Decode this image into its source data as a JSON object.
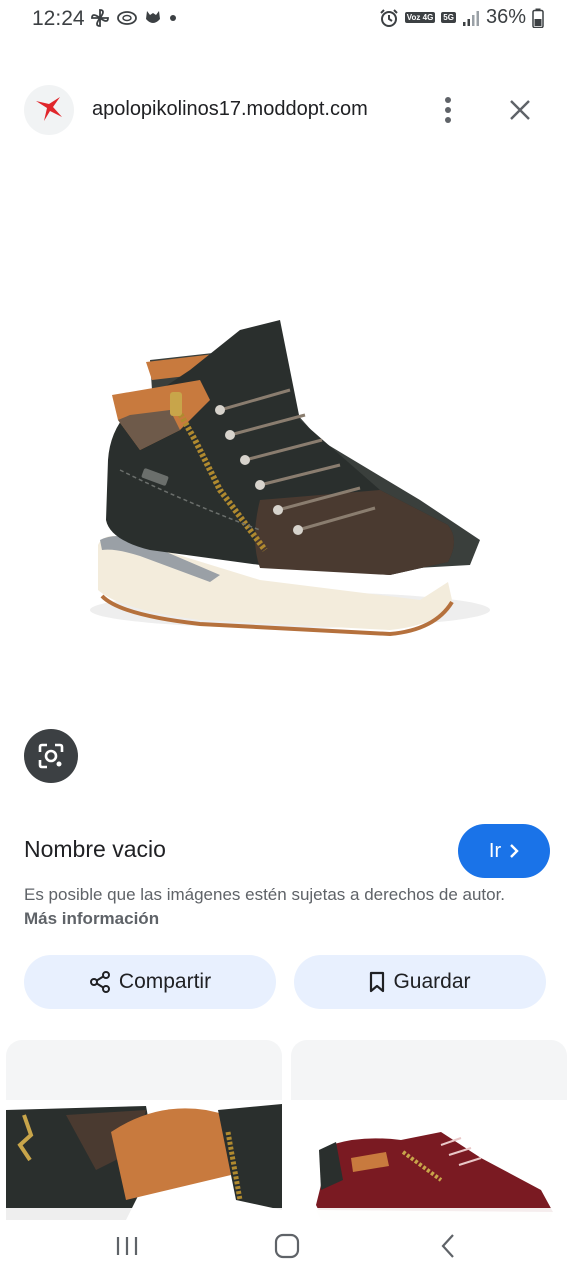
{
  "status_bar": {
    "time": "12:24",
    "battery": "36%",
    "icons": [
      "pinwheel-icon",
      "cast-icon",
      "paw-icon",
      "dot-icon",
      "alarm-icon",
      "volte-icon",
      "5g-icon",
      "signal-icon",
      "battery-icon"
    ],
    "badge_volte": "Voz 4G",
    "badge_5g": "5G"
  },
  "header": {
    "domain": "apolopikolinos17.moddopt.com",
    "logo_color": "#e0262b"
  },
  "result": {
    "title": "Nombre vacio",
    "go_label": "Ir",
    "copyright_text": "Es posible que las imágenes estén sujetas a derechos de autor.",
    "more_info_label": "Más información"
  },
  "actions": {
    "share_label": "Compartir",
    "save_label": "Guardar"
  },
  "colors": {
    "accent": "#1a73e8",
    "chip_bg": "#e8f0fe",
    "boot_dark": "#2a2f2d",
    "boot_brown": "#4a3a30",
    "boot_tan": "#c87a3e",
    "sole": "#f3ecdc",
    "red_shoe": "#7a1a22"
  }
}
